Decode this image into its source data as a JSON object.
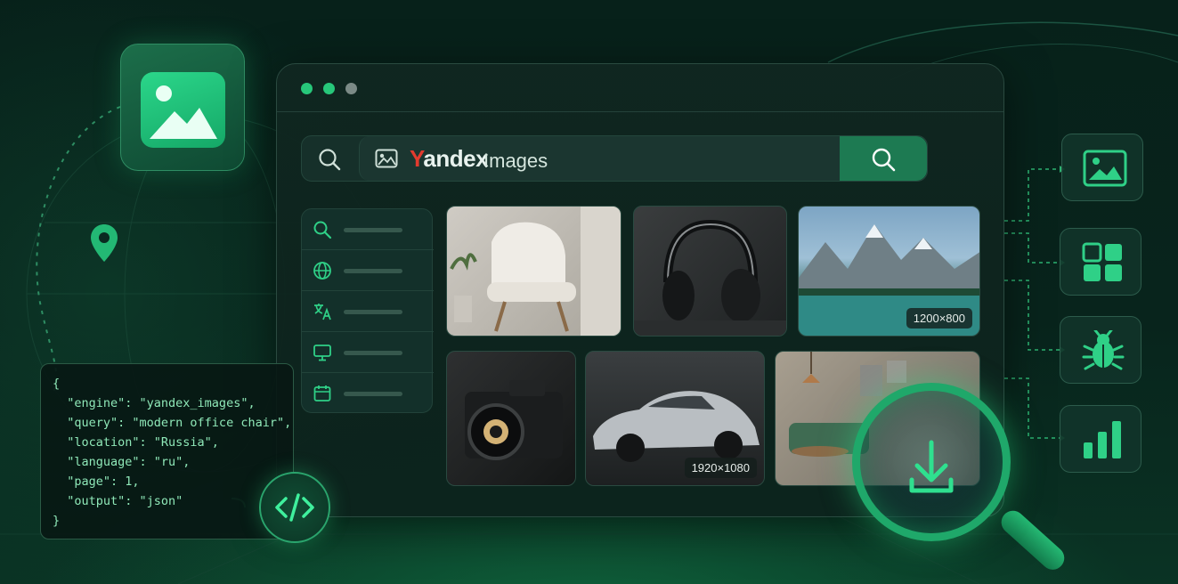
{
  "search": {
    "brand_initial": "Y",
    "brand_rest": "andex",
    "brand_suffix": "Images"
  },
  "thumbnails": [
    {
      "subject": "white armchair",
      "badge": ""
    },
    {
      "subject": "headphones",
      "badge": ""
    },
    {
      "subject": "mountain lake",
      "badge": "1200×800"
    },
    {
      "subject": "camera",
      "badge": ""
    },
    {
      "subject": "sports car",
      "badge": "1920×1080"
    },
    {
      "subject": "living room",
      "badge": ""
    }
  ],
  "sidebar": {
    "items": [
      {
        "icon": "search-icon"
      },
      {
        "icon": "globe-icon"
      },
      {
        "icon": "translate-icon"
      },
      {
        "icon": "monitor-icon"
      },
      {
        "icon": "calendar-icon"
      }
    ]
  },
  "code": {
    "lines": [
      "{",
      "  \"engine\": \"yandex_images\",",
      "  \"query\": \"modern office chair\",",
      "  \"location\": \"Russia\",",
      "  \"language\": \"ru\",",
      "  \"page\": 1,",
      "  \"output\": \"json\"",
      "}"
    ]
  },
  "right_tiles": [
    {
      "icon": "image-icon"
    },
    {
      "icon": "grid-icon"
    },
    {
      "icon": "bug-icon"
    },
    {
      "icon": "bar-chart-icon"
    }
  ],
  "colors": {
    "accent": "#27c77a",
    "brand_red": "#e23b2e",
    "background": "#07211a"
  }
}
